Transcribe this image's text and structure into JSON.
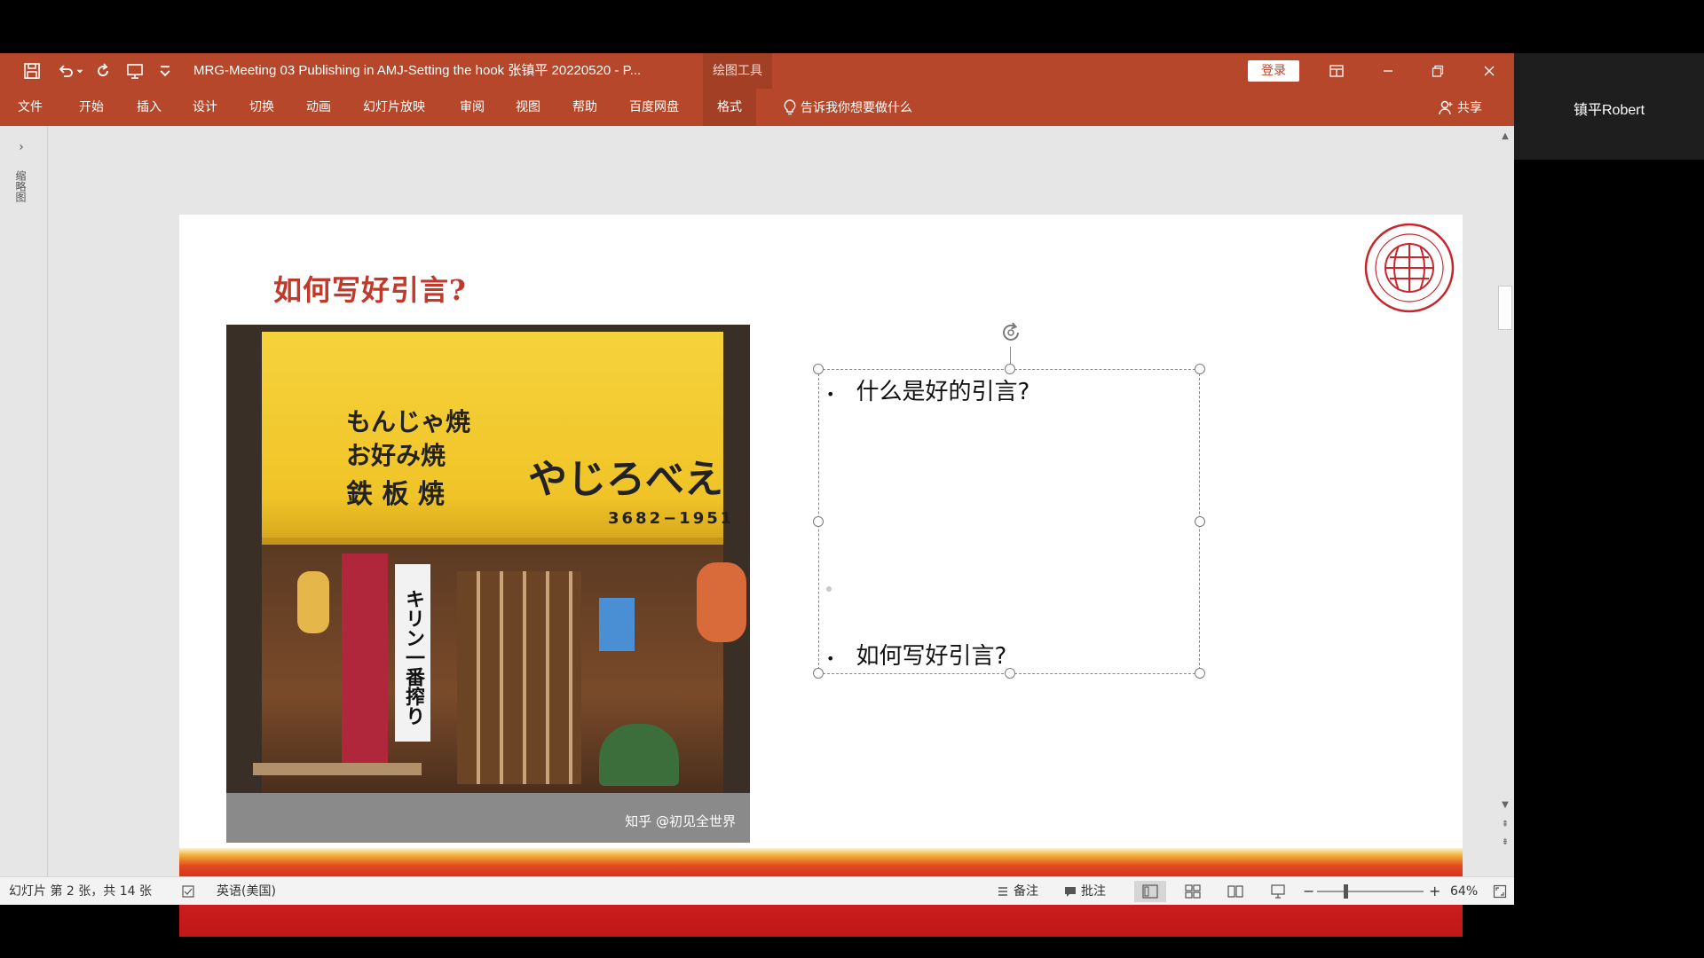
{
  "window": {
    "title": "MRG-Meeting 03 Publishing in AMJ-Setting the hook 张镇平 20220520 - P...",
    "contextual_tab": "绘图工具",
    "login_label": "登录"
  },
  "ribbon": {
    "tabs": [
      "文件",
      "开始",
      "插入",
      "设计",
      "切换",
      "动画",
      "幻灯片放映",
      "审阅",
      "视图",
      "帮助",
      "百度网盘",
      "格式"
    ],
    "active_tab": "格式",
    "tell_me": "告诉我你想要做什么",
    "share": "共享"
  },
  "user": {
    "name": "镇平Robert"
  },
  "thumbnail_pane": {
    "label": "缩略图"
  },
  "slide": {
    "title": "如何写好引言?",
    "bullets": [
      "什么是好的引言?",
      "如何写好引言?"
    ],
    "photo": {
      "awning_line_1": "もんじゃ焼",
      "awning_line_2": "お好み焼",
      "awning_line_3": "鉄 板 焼",
      "shop_name": "やじろべえ",
      "phone": "3682−1951",
      "banner": "キリン一番搾り",
      "watermark": "知乎 @初见全世界"
    }
  },
  "status_bar": {
    "slide_info": "幻灯片 第 2 张，共 14 张",
    "language": "英语(美国)",
    "notes": "备注",
    "comments": "批注",
    "zoom": "64%"
  },
  "colors": {
    "accent": "#b7472a",
    "slide_title": "#c0392b"
  }
}
